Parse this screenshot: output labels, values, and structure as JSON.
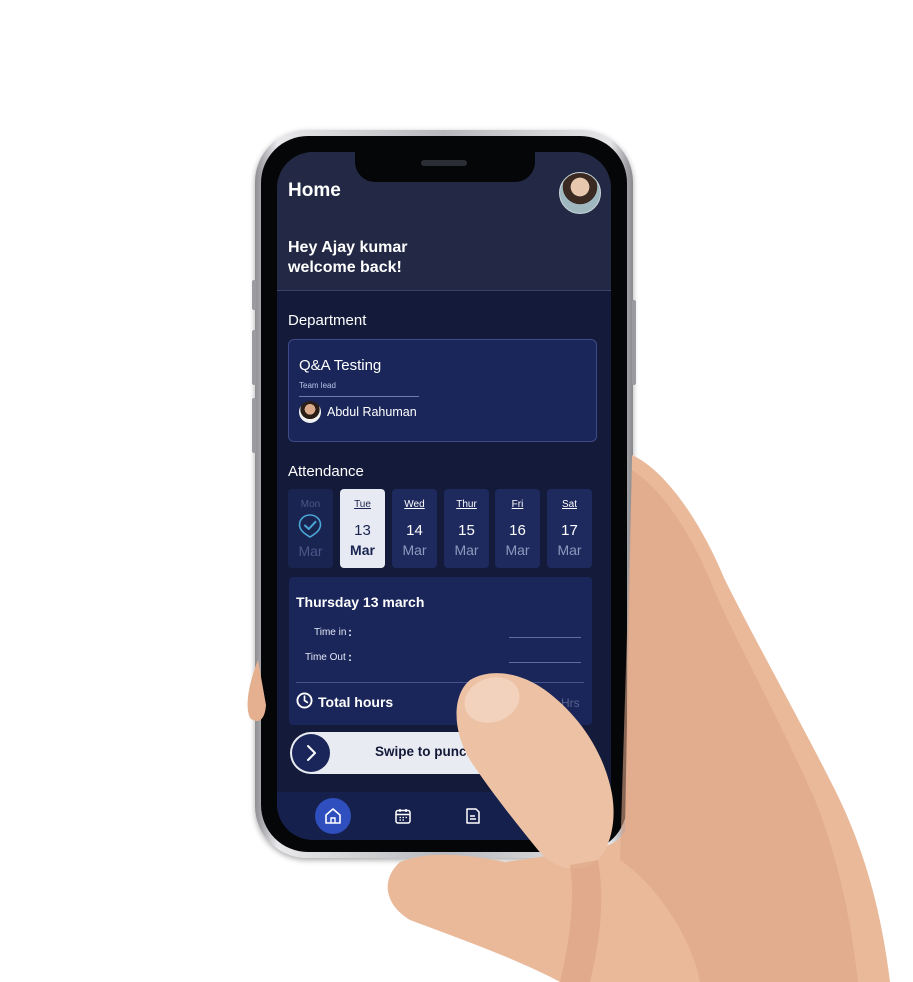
{
  "header": {
    "title": "Home",
    "greeting_line1": "Hey Ajay kumar",
    "greeting_line2": "welcome back!"
  },
  "department": {
    "section_label": "Department",
    "name": "Q&A Testing",
    "role_label": "Team lead",
    "lead_name": "Abdul Rahuman"
  },
  "attendance": {
    "section_label": "Attendance",
    "days": [
      {
        "day": "Mon",
        "date": "",
        "month": "Mar",
        "state": "past"
      },
      {
        "day": "Tue",
        "date": "13",
        "month": "Mar",
        "state": "active"
      },
      {
        "day": "Wed",
        "date": "14",
        "month": "Mar",
        "state": "normal"
      },
      {
        "day": "Thur",
        "date": "15",
        "month": "Mar",
        "state": "normal"
      },
      {
        "day": "Fri",
        "date": "16",
        "month": "Mar",
        "state": "normal"
      },
      {
        "day": "Sat",
        "date": "17",
        "month": "Mar",
        "state": "normal"
      }
    ],
    "selected_date": "Thursday 13 march",
    "time_in_label": "Time in",
    "time_out_label": "Time Out",
    "colon": ":",
    "total_hours_label": "Total hours",
    "hours_unit": "Hrs"
  },
  "swipe": {
    "label": "Swipe to punch i"
  },
  "nav": {
    "items": [
      {
        "icon": "home-icon",
        "active": true
      },
      {
        "icon": "calendar-icon",
        "active": false
      },
      {
        "icon": "document-icon",
        "active": false
      },
      {
        "icon": "folder-icon",
        "active": false
      }
    ]
  },
  "colors": {
    "background": "#141b3a",
    "header": "#232944",
    "card": "#1a2659",
    "accent": "#2f4fbe",
    "active_day": "#e7eaf2"
  }
}
